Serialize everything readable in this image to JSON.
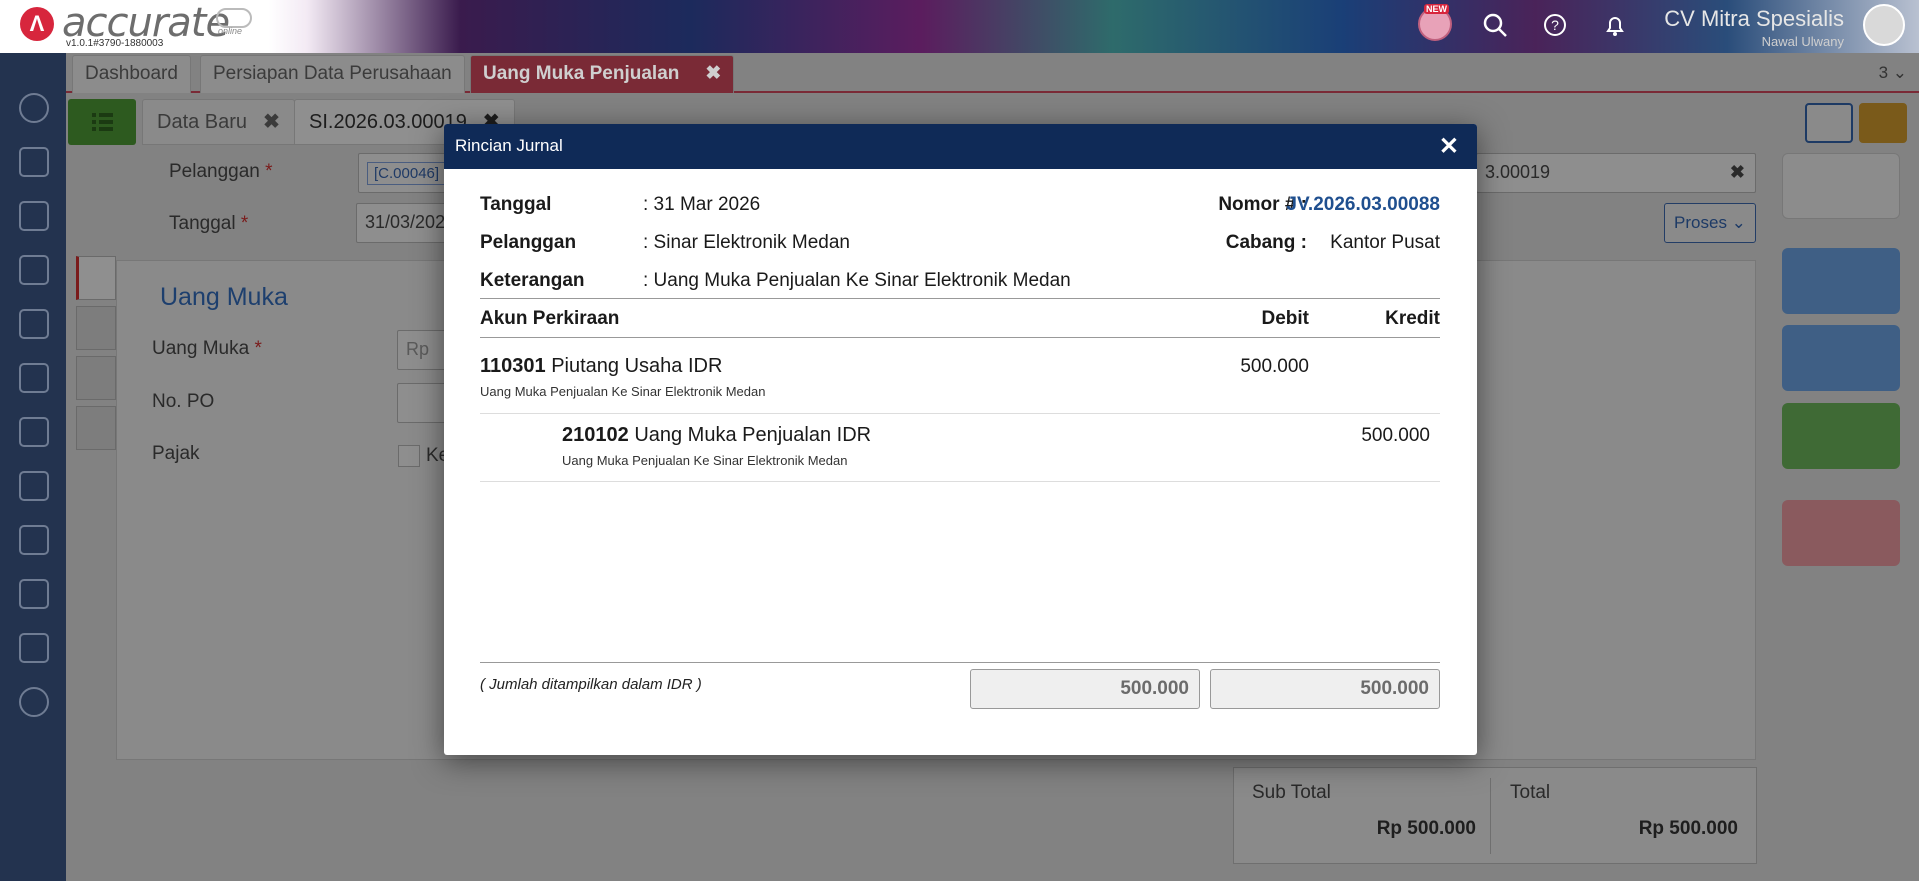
{
  "header": {
    "brand": "accurate",
    "brand_suffix": "online",
    "version": "v1.0.1#3790-1880003",
    "new_badge": "NEW",
    "company_name": "CV Mitra Spesialis",
    "user_name": "Nawal Ulwany"
  },
  "tabs": [
    {
      "label": "Dashboard"
    },
    {
      "label": "Persiapan Data Perusahaan"
    },
    {
      "label": "Uang Muka Penjualan",
      "close": "✖"
    }
  ],
  "tabs_count": "3 ⌄",
  "subtabs": [
    {
      "label": "Data Baru",
      "close": "✖"
    },
    {
      "label": "SI.2026.03.00019",
      "close": "✖"
    }
  ],
  "form": {
    "customer_label": "Pelanggan",
    "customer_chip": "[C.00046]",
    "date_label": "Tanggal",
    "date_value": "31/03/202",
    "number_value": "3.00019",
    "number_clear": "✖",
    "process_button": "Proses ⌄",
    "section_title": "Uang Muka",
    "advance_label": "Uang Muka",
    "advance_placeholder": "Rp",
    "po_label": "No. PO",
    "tax_label": "Pajak",
    "tax_checkbox_label": "Ke",
    "required_mark": "*"
  },
  "totals": {
    "subtotal_label": "Sub Total",
    "subtotal_value": "Rp 500.000",
    "total_label": "Total",
    "total_value": "Rp 500.000"
  },
  "modal": {
    "title": "Rincian Jurnal",
    "close": "✕",
    "date_label": "Tanggal",
    "date_value": ": 31 Mar 2026",
    "customer_label": "Pelanggan",
    "customer_value": ": Sinar Elektronik Medan",
    "note_label": "Keterangan",
    "note_value": ": Uang Muka Penjualan Ke Sinar Elektronik Medan",
    "number_label": "Nomor # :",
    "number_value": "JV.2026.03.00088",
    "branch_label": "Cabang :",
    "branch_value": "Kantor Pusat",
    "columns": {
      "account": "Akun Perkiraan",
      "debit": "Debit",
      "credit": "Kredit"
    },
    "rows": [
      {
        "code": "110301",
        "name": "Piutang Usaha IDR",
        "note": "Uang Muka Penjualan Ke Sinar Elektronik Medan",
        "debit": "500.000",
        "credit": ""
      },
      {
        "code": "210102",
        "name": "Uang Muka Penjualan IDR",
        "note": "Uang Muka Penjualan Ke Sinar Elektronik Medan",
        "debit": "",
        "credit": "500.000"
      }
    ],
    "footer_note": "( Jumlah ditampilkan dalam IDR )",
    "total_debit": "500.000",
    "total_credit": "500.000"
  }
}
